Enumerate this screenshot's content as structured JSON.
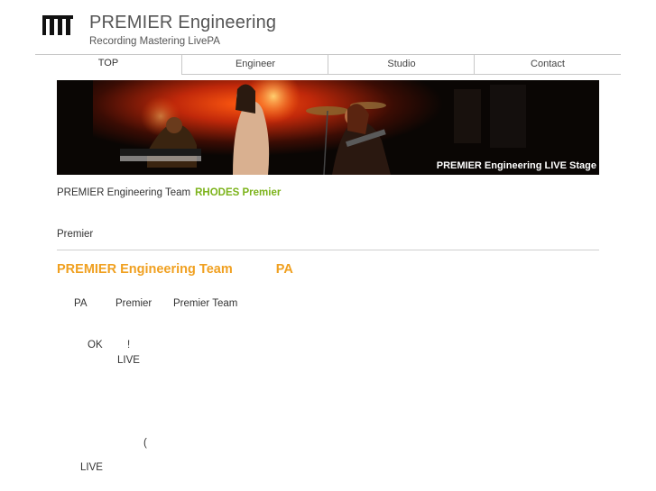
{
  "header": {
    "title": "PREMIER Engineering",
    "tagline": "Recording Mastering LivePA",
    "logo_icon": "piano-keys-icon"
  },
  "nav": {
    "tabs": [
      {
        "label": "TOP"
      },
      {
        "label": "Engineer"
      },
      {
        "label": "Studio"
      },
      {
        "label": "Contact"
      }
    ]
  },
  "banner": {
    "caption": "PREMIER Engineering LIVE Stage"
  },
  "content": {
    "intro_text": "PREMIER Engineering Team",
    "intro_highlight": "RHODES Premier",
    "premier_line": "Premier",
    "section_title": "PREMIER Engineering Team",
    "section_title_suffix": "PA",
    "line1": {
      "a": "PA",
      "b": "Premier",
      "c": "Premier Team"
    },
    "line2": {
      "a": "OK",
      "b": "!"
    },
    "line3": "LIVE",
    "line4": "(",
    "line5": "LIVE"
  },
  "colors": {
    "accent_orange": "#f0a020",
    "accent_green": "#7cb31b",
    "nav_border": "#c8c8c8"
  }
}
